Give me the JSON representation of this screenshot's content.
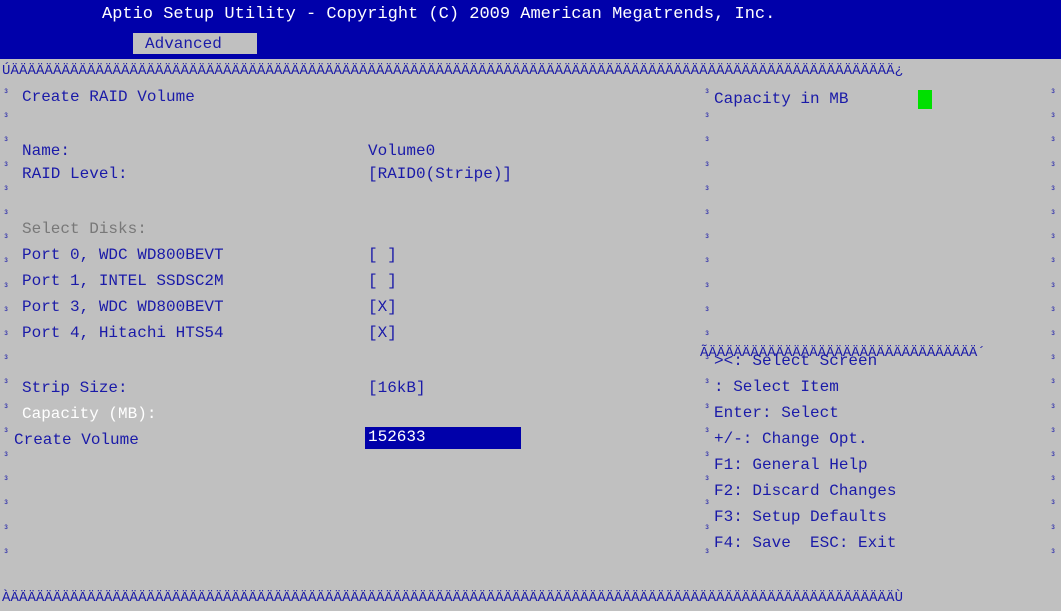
{
  "header": {
    "title": "Aptio Setup Utility - Copyright (C) 2009 American Megatrends, Inc.",
    "tab": "Advanced"
  },
  "frame": {
    "top_rule": "ÚÄÄÄÄÄÄÄÄÄÄÄÄÄÄÄÄÄÄÄÄÄÄÄÄÄÄÄÄÄÄÄÄÄÄÄÄÄÄÄÄÄÄÄÄÄÄÄÄÄÄÄÄÄÄÄÄÄÄÄÄÄÄÄÄÄÄÄÄÄÄÄÄÄÄÄÄÄÄÄÄÄÄÄÄÄÄÄÄÄÄÄÄÄÄÄÄÄÄÄÄÄÄÄÄ¿",
    "bottom_rule": "ÀÄÄÄÄÄÄÄÄÄÄÄÄÄÄÄÄÄÄÄÄÄÄÄÄÄÄÄÄÄÄÄÄÄÄÄÄÄÄÄÄÄÄÄÄÄÄÄÄÄÄÄÄÄÄÄÄÄÄÄÄÄÄÄÄÄÄÄÄÄÄÄÄÄÄÄÄÄÄÄÄÄÄÄÄÄÄÄÄÄÄÄÄÄÄÄÄÄÄÄÄÄÄÄÄÙ",
    "divider_rule": "ÃÄÄÄÄÄÄÄÄÄÄÄÄÄÄÄÄÄÄÄÄÄÄÄÄÄÄÄÄÄÄÄÄ´",
    "marker": "³"
  },
  "form": {
    "heading": "Create RAID Volume",
    "name_label": "Name:",
    "name_value": "Volume0",
    "raid_level_label": "RAID Level:",
    "raid_level_value": "[RAID0(Stripe)]",
    "select_disks_label": "Select Disks:",
    "disks": [
      {
        "label": "Port 0, WDC WD800BEVT",
        "value": "[ ]"
      },
      {
        "label": "Port 1, INTEL SSDSC2M",
        "value": "[ ]"
      },
      {
        "label": "Port 3, WDC WD800BEVT",
        "value": "[X]"
      },
      {
        "label": "Port 4, Hitachi HTS54",
        "value": "[X]"
      }
    ],
    "strip_size_label": "Strip Size:",
    "strip_size_value": "[16kB]",
    "capacity_label": "Capacity (MB):",
    "capacity_value": "152633",
    "create_volume": "Create Volume"
  },
  "help": {
    "title": "Capacity in MB",
    "keys": [
      "><: Select Screen",
      ": Select Item",
      "Enter: Select",
      "+/-: Change Opt.",
      "F1: General Help",
      "F2: Discard Changes",
      "F3: Setup Defaults",
      "F4: Save  ESC: Exit"
    ]
  }
}
